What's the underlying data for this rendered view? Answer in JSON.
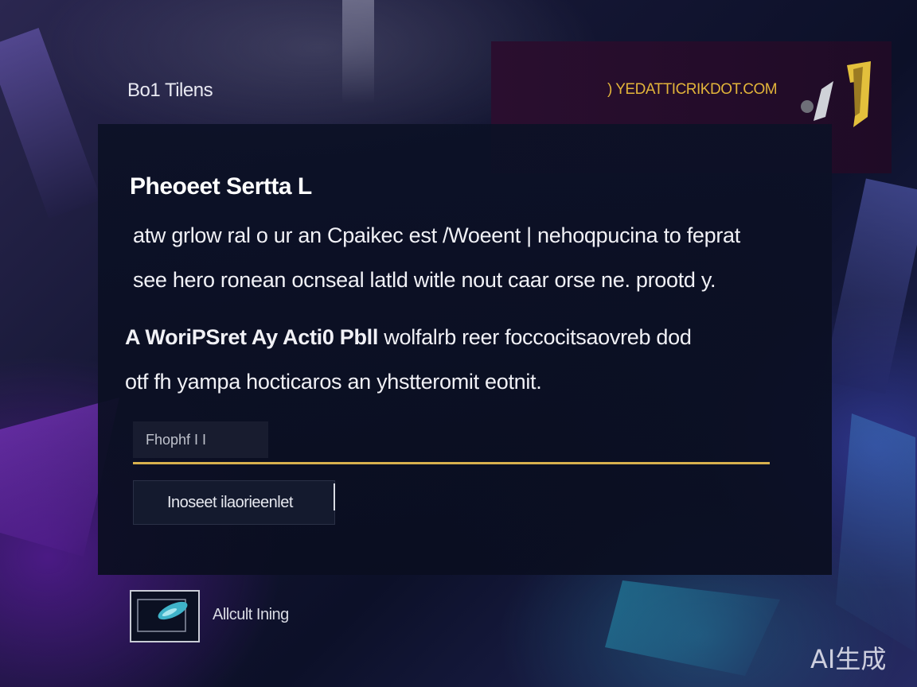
{
  "header": {
    "label": "Bo1 Tilens"
  },
  "banner": {
    "text": ") YEDATTICRIKDOT.COM"
  },
  "card": {
    "title": "Pheoeet Sertta L",
    "paragraph_1": [
      "atw grlow ral o ur an Cpaikec est /Woeent | nehoqpucina to feprat",
      "see hero ronean ocnseal latld witle nout caar orse ne. prootd y."
    ],
    "paragraph_2": {
      "lead": "A WoriPSret Ay Acti0 Pbll",
      "rest": " wolfalrb reer foccocitsaovreb dod",
      "line_2": "otf fh yampa hocticaros an yhstteromit eotnit."
    },
    "input": {
      "value": "Fhophf I I"
    },
    "action_button": {
      "label": "Inoseet ilaorieenlet"
    }
  },
  "attachment": {
    "label": "Allcult Ining"
  },
  "watermark": {
    "text": "AI生成"
  },
  "colors": {
    "accent": "#d8b14e",
    "banner_text": "#e2b43a",
    "card_bg": "#0c1126",
    "banner_bg": "#230d2a"
  }
}
